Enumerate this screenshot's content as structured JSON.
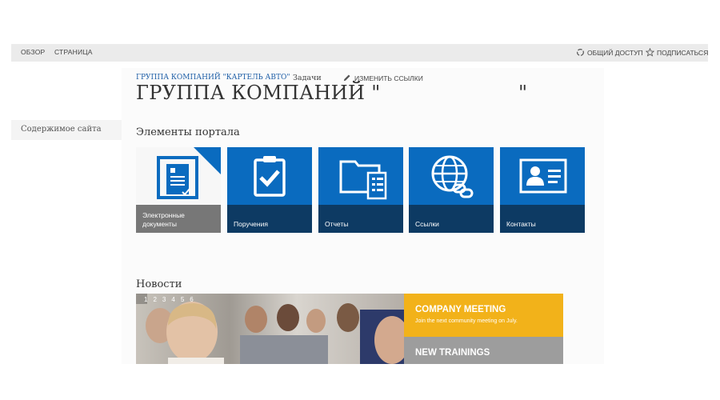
{
  "ribbon": {
    "tabs": [
      "ОБЗОР",
      "СТРАНИЦА"
    ],
    "share_label": "ОБЩИЙ ДОСТУП",
    "follow_label": "ПОДПИСАТЬСЯ"
  },
  "leftnav": {
    "site_contents": "Содержимое сайта"
  },
  "header": {
    "breadcrumb": "ГРУППА КОМПАНИЙ \"КАРТЕЛЬ АВТО\"",
    "tasks": "Задачи",
    "edit_links": "ИЗМЕНИТЬ ССЫЛКИ",
    "title_main": "ГРУППА КОМПАНИЙ \"",
    "title_end": "\""
  },
  "portal": {
    "title": "Элементы портала",
    "tiles": [
      {
        "label": "Электронные документы",
        "icon": "document-icon"
      },
      {
        "label": "Поручения",
        "icon": "clipboard-check-icon"
      },
      {
        "label": "Отчеты",
        "icon": "folder-report-icon"
      },
      {
        "label": "Ссылки",
        "icon": "globe-link-icon"
      },
      {
        "label": "Контакты",
        "icon": "contact-card-icon"
      }
    ]
  },
  "news": {
    "title": "Новости",
    "pager": [
      "1",
      "2",
      "3",
      "4",
      "5",
      "6"
    ],
    "slides": [
      {
        "title": "COMPANY MEETING",
        "subtitle": "Join the next community meeting on July."
      },
      {
        "title": "NEW TRAININGS",
        "subtitle": ""
      }
    ]
  },
  "colors": {
    "tile_blue": "#0a6bbf",
    "tile_caption": "#0d3a63",
    "link_blue": "#1f5fa7",
    "slide_yellow": "#f2b21a",
    "slide_gray": "#9d9d9d"
  }
}
